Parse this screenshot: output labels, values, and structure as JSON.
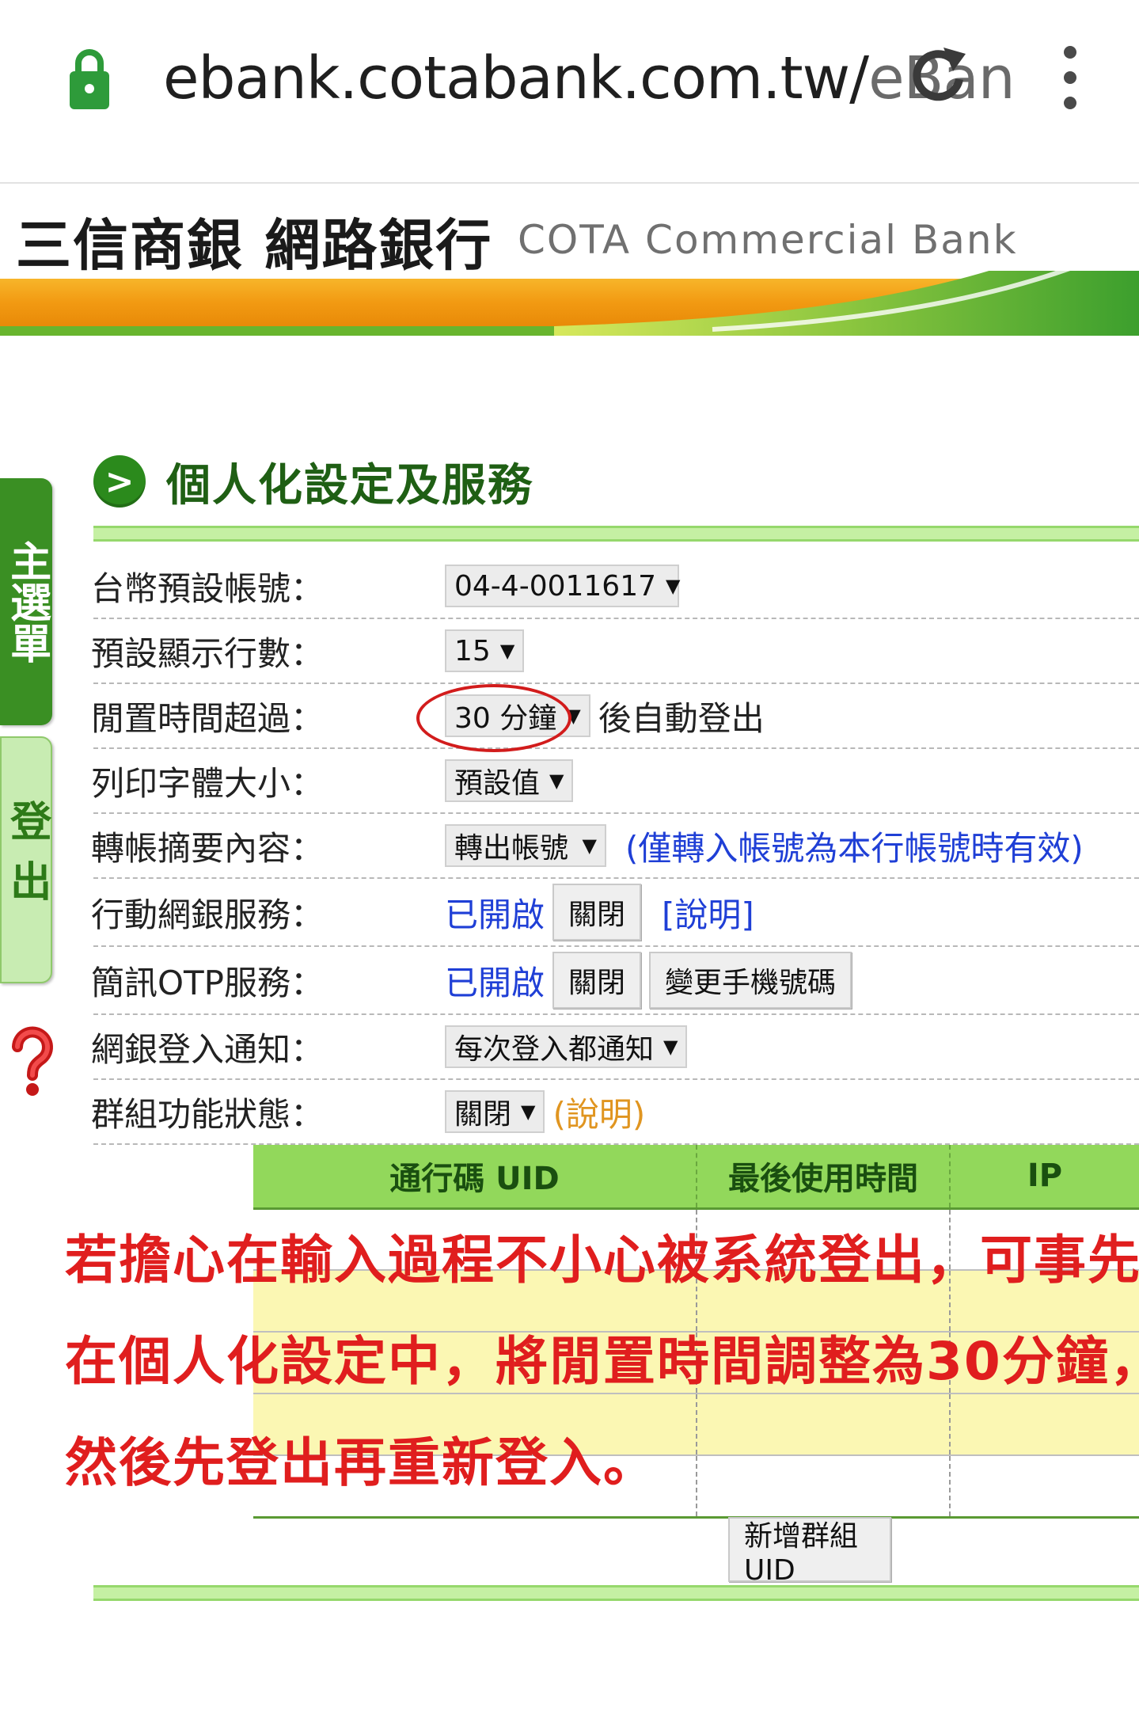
{
  "browser": {
    "url_main": "ebank.cotabank.com.tw/",
    "url_faded": "eBan"
  },
  "header": {
    "title_zh": "三信商銀  網路銀行",
    "title_en": "COTA Commercial Bank"
  },
  "sidebar": {
    "menu_label": "主選單",
    "logout_label": "登出"
  },
  "section": {
    "title": "個人化設定及服務"
  },
  "settings": {
    "default_account": {
      "label": "台幣預設帳號：",
      "value": "04-4-0011617"
    },
    "rows_per_page": {
      "label": "預設顯示行數：",
      "value": "15"
    },
    "idle_timeout": {
      "label": "閒置時間超過：",
      "value": "30 分鐘",
      "suffix": "後自動登出"
    },
    "font_size": {
      "label": "列印字體大小：",
      "value": "預設值"
    },
    "transfer_memo": {
      "label": "轉帳摘要內容：",
      "value": "轉出帳號",
      "note": "(僅轉入帳號為本行帳號時有效)"
    },
    "mobile_banking": {
      "label": "行動網銀服務：",
      "status": "已開啟",
      "close_button": "關閉",
      "help_link": "[說明]"
    },
    "sms_otp": {
      "label": "簡訊OTP服務：",
      "status": "已開啟",
      "close_button": "關閉",
      "change_phone_button": "變更手機號碼"
    },
    "login_notice": {
      "label": "網銀登入通知：",
      "value": "每次登入都通知"
    },
    "group_status": {
      "label": "群組功能狀態：",
      "value": "關閉",
      "help_link": "(說明)"
    }
  },
  "uid_table": {
    "headers": [
      "通行碼 UID",
      "最後使用時間",
      "IP"
    ],
    "add_button": "新增群組UID"
  },
  "annotation": {
    "line1": "若擔心在輸入過程不小心被系統登出，可事先",
    "line2": "在個人化設定中，將閒置時間調整為30分鐘，",
    "line3": "然後先登出再重新登入。",
    "color": "#e01e1e"
  }
}
